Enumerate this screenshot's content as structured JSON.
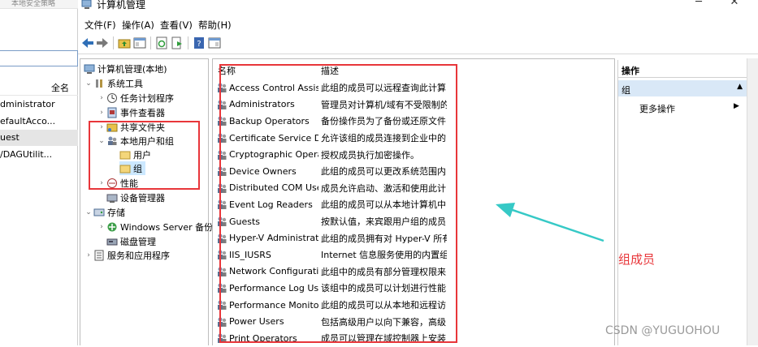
{
  "background_window": {
    "top_text": "本地安全策略",
    "column_header": "全名",
    "rows": [
      "dministrator",
      "efaultAcco...",
      "uest",
      "/DAGUtilit..."
    ],
    "selected_row": 2
  },
  "window": {
    "title": "计算机管理",
    "caption": {
      "minimize": "─",
      "maximize": "☐",
      "close": "✕"
    }
  },
  "menu": [
    "文件(F)",
    "操作(A)",
    "查看(V)",
    "帮助(H)"
  ],
  "toolbar": [
    "back-arrow-icon",
    "forward-arrow-icon",
    "up-folder-icon",
    "show-hide-tree-icon",
    "refresh-icon",
    "export-icon",
    "help-icon",
    "properties-icon"
  ],
  "tree": {
    "root": "计算机管理(本地)",
    "system_tools": "系统工具",
    "task_scheduler": "任务计划程序",
    "event_viewer": "事件查看器",
    "shared_folders": "共享文件夹",
    "local_users_groups": "本地用户和组",
    "users": "用户",
    "groups": "组",
    "performance": "性能",
    "device_manager": "设备管理器",
    "storage": "存储",
    "windows_server_backup": "Windows Server 备份",
    "disk_management": "磁盘管理",
    "services_apps": "服务和应用程序"
  },
  "list": {
    "columns": {
      "name": "名称",
      "description": "描述"
    },
    "rows": [
      {
        "name": "Access Control Assist...",
        "description": "此组的成员可以远程查询此计算..."
      },
      {
        "name": "Administrators",
        "description": "管理员对计算机/域有不受限制的..."
      },
      {
        "name": "Backup Operators",
        "description": "备份操作员为了备份或还原文件..."
      },
      {
        "name": "Certificate Service D...",
        "description": "允许该组的成员连接到企业中的..."
      },
      {
        "name": "Cryptographic Operat...",
        "description": "授权成员执行加密操作。"
      },
      {
        "name": "Device Owners",
        "description": "此组的成员可以更改系统范围内..."
      },
      {
        "name": "Distributed COM Users",
        "description": "成员允许启动、激活和使用此计..."
      },
      {
        "name": "Event Log Readers",
        "description": "此组的成员可以从本地计算机中..."
      },
      {
        "name": "Guests",
        "description": "按默认值，来宾跟用户组的成员..."
      },
      {
        "name": "Hyper-V Administrat...",
        "description": "此组的成员拥有对 Hyper-V 所有..."
      },
      {
        "name": "IIS_IUSRS",
        "description": "Internet 信息服务使用的内置组。"
      },
      {
        "name": "Network Configuratio...",
        "description": "此组中的成员有部分管理权限来..."
      },
      {
        "name": "Performance Log Users",
        "description": "该组中的成员可以计划进行性能..."
      },
      {
        "name": "Performance Monitor...",
        "description": "此组的成员可以从本地和远程访..."
      },
      {
        "name": "Power Users",
        "description": "包括高级用户以向下兼容，高级..."
      },
      {
        "name": "Print Operators",
        "description": "成员可以管理在域控制器上安装..."
      }
    ]
  },
  "actions": {
    "header": "操作",
    "group": "组",
    "more": "更多操作"
  },
  "annotation": "组成员",
  "watermark": "CSDN @YUGUOHOU",
  "colors": {
    "highlight": "#e8363a",
    "arrow": "#36c9c6",
    "selection": "#cce8ff"
  }
}
